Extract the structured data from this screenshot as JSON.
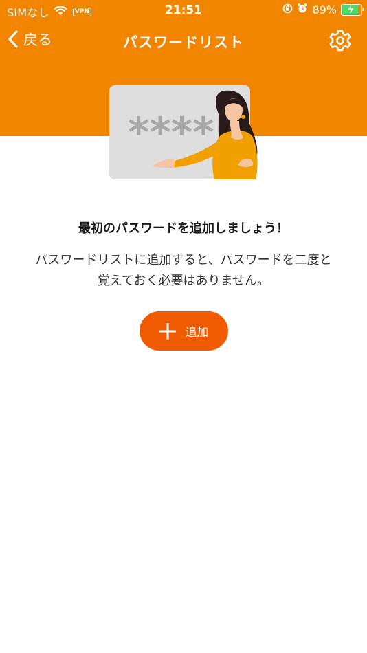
{
  "status_bar": {
    "carrier": "SIMなし",
    "vpn": "VPN",
    "time": "21:51",
    "battery_percent": "89%",
    "battery_level": 0.89
  },
  "nav": {
    "back_label": "戻る",
    "title": "パスワードリスト"
  },
  "illustration": {
    "card_text": "****"
  },
  "empty_state": {
    "heading": "最初のパスワードを追加しましょう！",
    "line1": "パスワードリストに追加すると、パスワードを二度と",
    "line2": "覚えておく必要はありません。"
  },
  "add_button": {
    "label": "追加"
  },
  "colors": {
    "header": "#f28500",
    "button": "#f05a00"
  }
}
